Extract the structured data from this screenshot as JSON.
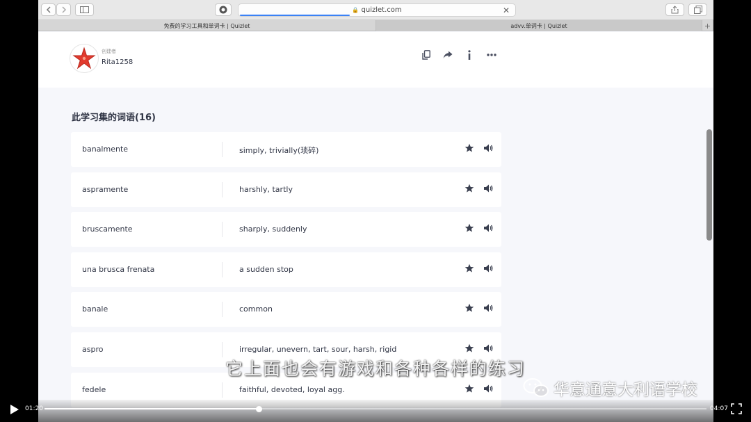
{
  "browser": {
    "url": "quizlet.com",
    "tabs": [
      {
        "label": "免费的学习工具和单词卡 | Quizlet",
        "active": false
      },
      {
        "label": "advv.单词卡 | Quizlet",
        "active": true
      }
    ]
  },
  "creator": {
    "label": "创建者",
    "name": "Rita1258"
  },
  "set": {
    "heading": "此学习集的词语(16)",
    "terms": [
      {
        "term": "banalmente",
        "definition": "simply, trivially(琐碎)"
      },
      {
        "term": "aspramente",
        "definition": "harshly, tartly"
      },
      {
        "term": "bruscamente",
        "definition": "sharply, suddenly"
      },
      {
        "term": "una brusca frenata",
        "definition": "a sudden stop"
      },
      {
        "term": "banale",
        "definition": "common"
      },
      {
        "term": "aspro",
        "definition": "irregular, unevern, tart, sour, harsh, rigid"
      },
      {
        "term": "fedele",
        "definition": "faithful, devoted, loyal agg."
      }
    ]
  },
  "video": {
    "subtitle": "它上面也会有游戏和各种各样的练习",
    "watermark": "华意通意大利语学校",
    "current_time": "01:20",
    "duration": "04:07",
    "progress": 0.324
  },
  "colors": {
    "avatar_star": "#e23b2e",
    "progress": "#3b82f6"
  }
}
